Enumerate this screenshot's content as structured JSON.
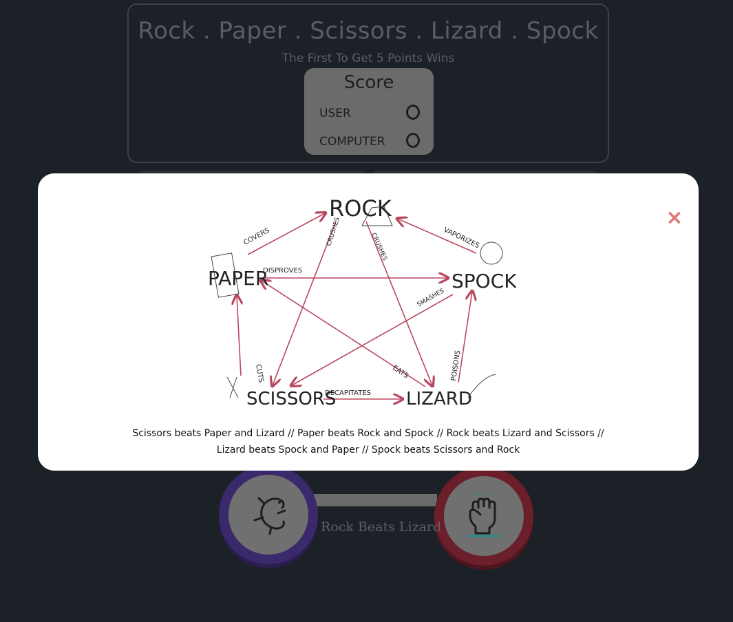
{
  "game": {
    "title": "Rock . Paper . Scissors . Lizard . Spock",
    "subtitle": "The First To Get 5 Points Wins"
  },
  "score": {
    "title": "Score",
    "user_label": "USER",
    "user_value": "0",
    "computer_label": "COMPUTER",
    "computer_value": "0"
  },
  "round": {
    "user_choice_icon": "lizard-icon",
    "computer_choice_icon": "rock-fist-icon",
    "result_text": "Rock Beats Lizard"
  },
  "rules_modal": {
    "close_label": "×",
    "diagram": {
      "nodes": {
        "rock": "ROCK",
        "paper": "PAPER",
        "scissors": "SCISSORS",
        "lizard": "LIZARD",
        "spock": "SPOCK"
      },
      "verbs": {
        "covers": "COVERS",
        "crushes_scissors": "CRUSHES",
        "crushes_lizard": "CRUSHES",
        "vaporizes": "VAPORIZES",
        "disproves": "DISPROVES",
        "smashes": "SMASHES",
        "cuts": "CUTS",
        "eats": "EATS",
        "poisons": "POISONS",
        "decapitates": "DECAPITATES"
      }
    },
    "rules_line_1": "Scissors beats Paper and Lizard // Paper beats Rock and Spock // Rock beats Lizard and Scissors //",
    "rules_line_2": "Lizard beats Spock and Paper // Spock beats Scissors and Rock"
  },
  "colors": {
    "background": "#1b2127",
    "arrow": "#b8475e",
    "close": "#e0757b",
    "user_ring": "#3a2a6b",
    "computer_ring": "#6b1f2a"
  }
}
